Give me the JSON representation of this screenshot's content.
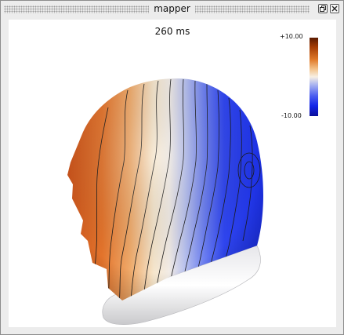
{
  "window": {
    "title": "mapper"
  },
  "view": {
    "time_label": "260 ms"
  },
  "colorbar": {
    "max_label": "+10.00",
    "min_label": "-10.00",
    "colors": [
      "#5a1a00",
      "#e07a2a",
      "#f7f0e4",
      "#4d5ff0",
      "#0a0f9a"
    ]
  },
  "icons": {
    "restore": "restore-icon",
    "close": "close-icon"
  }
}
